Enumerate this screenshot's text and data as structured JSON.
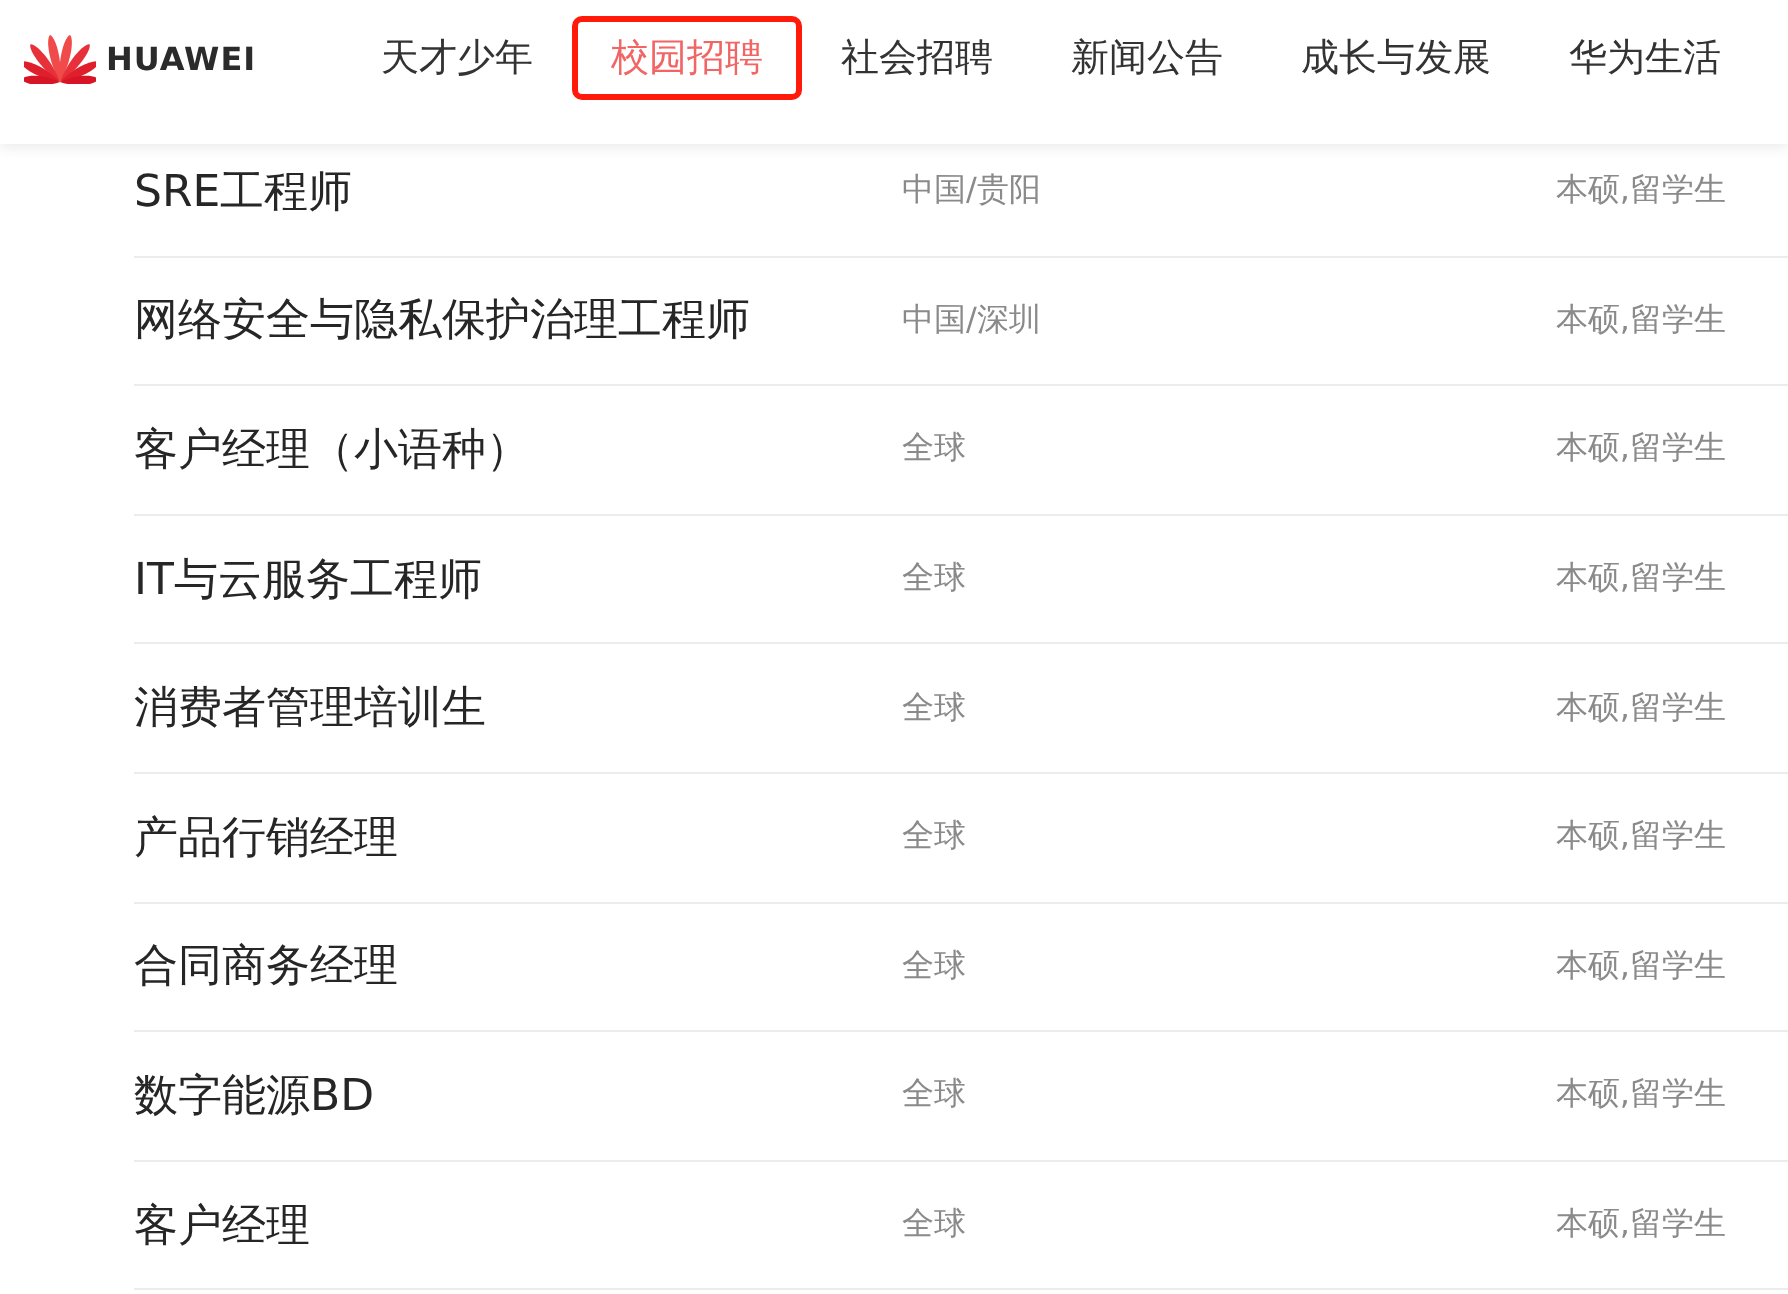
{
  "header": {
    "logo": {
      "text": "HUAWEI"
    },
    "nav": [
      {
        "label": "天才少年",
        "selected": false
      },
      {
        "label": "校园招聘",
        "selected": true
      },
      {
        "label": "社会招聘",
        "selected": false
      },
      {
        "label": "新闻公告",
        "selected": false
      },
      {
        "label": "成长与发展",
        "selected": false
      },
      {
        "label": "华为生活",
        "selected": false
      }
    ]
  },
  "jobs": [
    {
      "title": "SRE工程师",
      "location": "中国/贵阳",
      "degree": "本硕,留学生"
    },
    {
      "title": "网络安全与隐私保护治理工程师",
      "location": "中国/深圳",
      "degree": "本硕,留学生"
    },
    {
      "title": "客户经理（小语种）",
      "location": "全球",
      "degree": "本硕,留学生"
    },
    {
      "title": "IT与云服务工程师",
      "location": "全球",
      "degree": "本硕,留学生"
    },
    {
      "title": "消费者管理培训生",
      "location": "全球",
      "degree": "本硕,留学生"
    },
    {
      "title": "产品行销经理",
      "location": "全球",
      "degree": "本硕,留学生"
    },
    {
      "title": "合同商务经理",
      "location": "全球",
      "degree": "本硕,留学生"
    },
    {
      "title": "数字能源BD",
      "location": "全球",
      "degree": "本硕,留学生"
    },
    {
      "title": "客户经理",
      "location": "全球",
      "degree": "本硕,留学生"
    }
  ]
}
